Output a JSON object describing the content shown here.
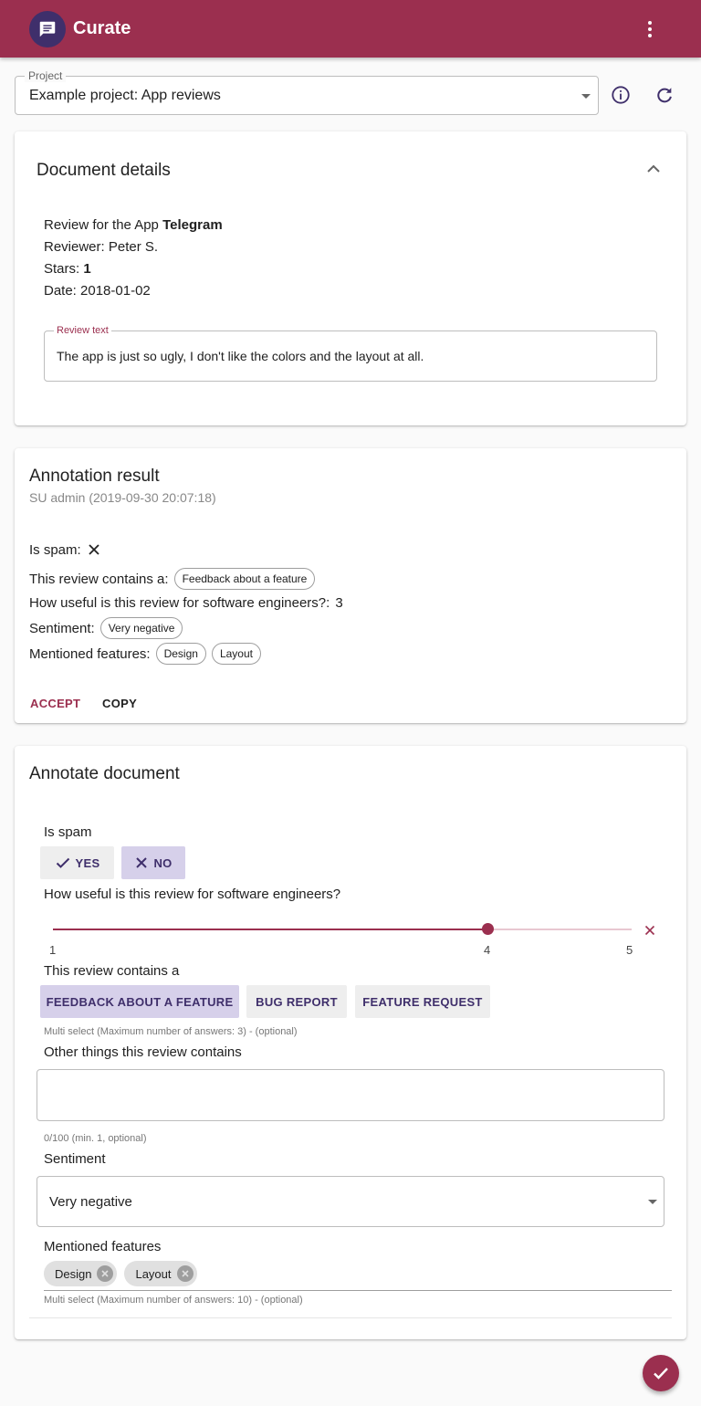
{
  "app": {
    "title": "Curate",
    "logo_icon": "chat-icon",
    "menu_icon": "more-vert-icon",
    "primary_color": "#9b2f4f",
    "secondary_color": "#3f2f6b"
  },
  "project": {
    "label": "Project",
    "value": "Example project: App reviews",
    "info_icon": "info-icon",
    "refresh_icon": "refresh-icon"
  },
  "document": {
    "title": "Document details",
    "collapse_icon": "chevron-up-icon",
    "app_prefix": "Review for the App",
    "app_name": "Telegram",
    "reviewer_label": "Reviewer:",
    "reviewer": "Peter S.",
    "stars_label": "Stars:",
    "stars": "1",
    "date_label": "Date:",
    "date": "2018-01-02",
    "review_text_label": "Review text",
    "review_text": "The app is just so ugly, I don't like the colors and the layout at all."
  },
  "result": {
    "title": "Annotation result",
    "subtitle": "SU admin (2019-09-30 20:07:18)",
    "spam_label": "Is spam:",
    "spam_icon": "close-icon",
    "contains_label": "This review contains a:",
    "contains_chip": "Feedback about a feature",
    "useful_label": "How useful is this review for software engineers?:",
    "useful_value": "3",
    "sentiment_label": "Sentiment:",
    "sentiment_chip": "Very negative",
    "features_label": "Mentioned features:",
    "features_chips": [
      "Design",
      "Layout"
    ],
    "accept_label": "ACCEPT",
    "copy_label": "COPY"
  },
  "annotate": {
    "title": "Annotate document",
    "spam_question": "Is spam",
    "yes_label": "YES",
    "no_label": "NO",
    "spam_selected": "NO",
    "useful_question": "How useful is this review for software engineers?",
    "slider": {
      "min": 1,
      "max": 5,
      "value": 4,
      "min_label": "1",
      "value_label": "4",
      "max_label": "5"
    },
    "contains_question": "This review contains a",
    "contains_options": [
      "FEEDBACK ABOUT A FEATURE",
      "BUG REPORT",
      "FEATURE REQUEST"
    ],
    "contains_selected": "FEEDBACK ABOUT A FEATURE",
    "contains_hint": "Multi select (Maximum number of answers: 3) - (optional)",
    "other_question": "Other things this review contains",
    "other_value": "",
    "other_hint": "0/100 (min. 1, optional)",
    "sentiment_question": "Sentiment",
    "sentiment_value": "Very negative",
    "features_question": "Mentioned features",
    "features_chips": [
      "Design",
      "Layout"
    ],
    "features_hint": "Multi select (Maximum number of answers: 10) - (optional)"
  },
  "fab_icon": "check-icon"
}
